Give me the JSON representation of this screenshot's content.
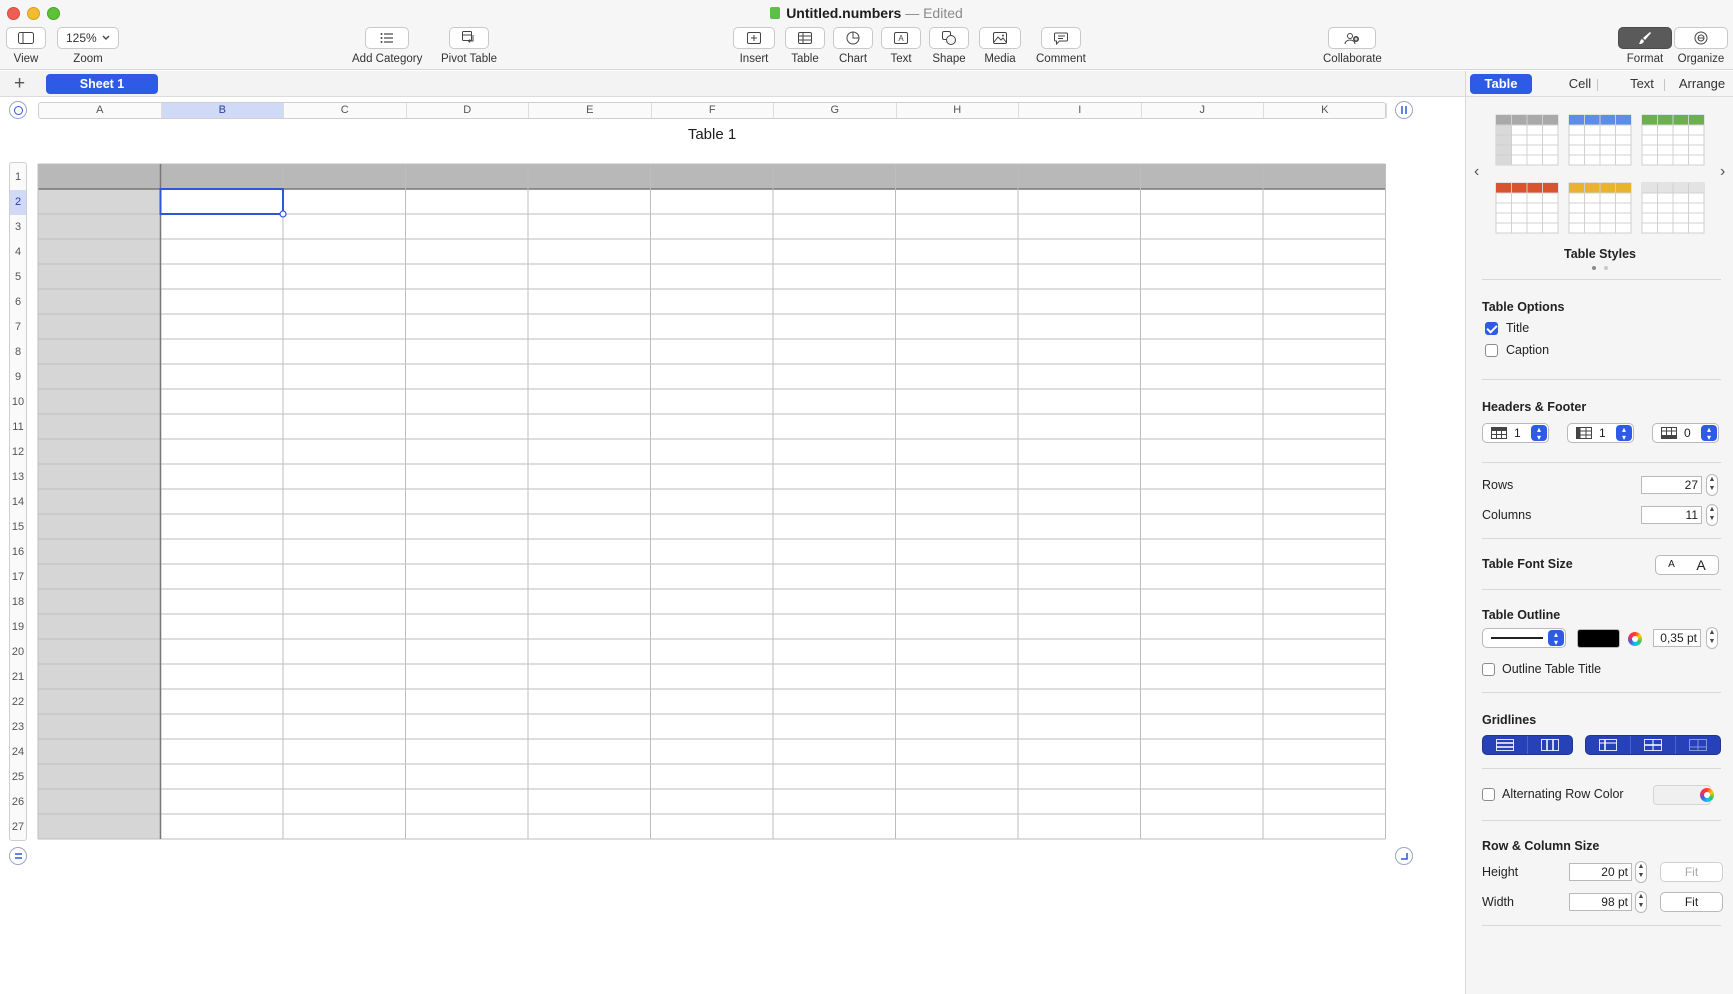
{
  "window": {
    "doc_name": "Untitled.numbers",
    "separator": "—",
    "status": "Edited"
  },
  "toolbar": {
    "view_label": "View",
    "zoom_value": "125%",
    "zoom_label": "Zoom",
    "add_category_label": "Add Category",
    "pivot_table_label": "Pivot Table",
    "insert_label": "Insert",
    "table_label": "Table",
    "chart_label": "Chart",
    "text_label": "Text",
    "shape_label": "Shape",
    "media_label": "Media",
    "comment_label": "Comment",
    "collaborate_label": "Collaborate",
    "format_label": "Format",
    "organize_label": "Organize"
  },
  "sheets": {
    "add_symbol": "+",
    "active_tab": "Sheet 1"
  },
  "table": {
    "title": "Table 1",
    "columns": [
      "A",
      "B",
      "C",
      "D",
      "E",
      "F",
      "G",
      "H",
      "I",
      "J",
      "K"
    ],
    "selected_column": "B",
    "rows": [
      "1",
      "2",
      "3",
      "4",
      "5",
      "6",
      "7",
      "8",
      "9",
      "10",
      "11",
      "12",
      "13",
      "14",
      "15",
      "16",
      "17",
      "18",
      "19",
      "20",
      "21",
      "22",
      "23",
      "24",
      "25",
      "26",
      "27"
    ],
    "selected_row": "2",
    "header_row_color": "#b8b8b8",
    "header_column_color": "#d6d6d6",
    "selection_color": "#2f56d9"
  },
  "inspector": {
    "tabs": [
      {
        "label": "Table",
        "active": true
      },
      {
        "label": "Cell",
        "active": false
      },
      {
        "label": "Text",
        "active": false
      },
      {
        "label": "Arrange",
        "active": false
      }
    ],
    "table_styles_title": "Table Styles",
    "style_colors": [
      "#a9a9a9",
      "#5b8ee6",
      "#6ab04c",
      "#d9532c",
      "#e9b330",
      "#e3e3e3"
    ],
    "table_options_title": "Table Options",
    "title_option": "Title",
    "title_checked": true,
    "caption_option": "Caption",
    "caption_checked": false,
    "headers_footer_title": "Headers & Footer",
    "header_rows": "1",
    "header_columns": "1",
    "footer_rows": "0",
    "rows_label": "Rows",
    "rows_value": "27",
    "columns_label": "Columns",
    "columns_value": "11",
    "font_size_label": "Table Font Size",
    "font_small": "A",
    "font_large": "A",
    "outline_title": "Table Outline",
    "outline_color": "#000000",
    "outline_width": "0,35 pt",
    "outline_title_option": "Outline Table Title",
    "gridlines_title": "Gridlines",
    "alternating_label": "Alternating Row Color",
    "row_col_size_title": "Row & Column Size",
    "height_label": "Height",
    "height_value": "20 pt",
    "width_label": "Width",
    "width_value": "98 pt",
    "fit_label": "Fit"
  }
}
